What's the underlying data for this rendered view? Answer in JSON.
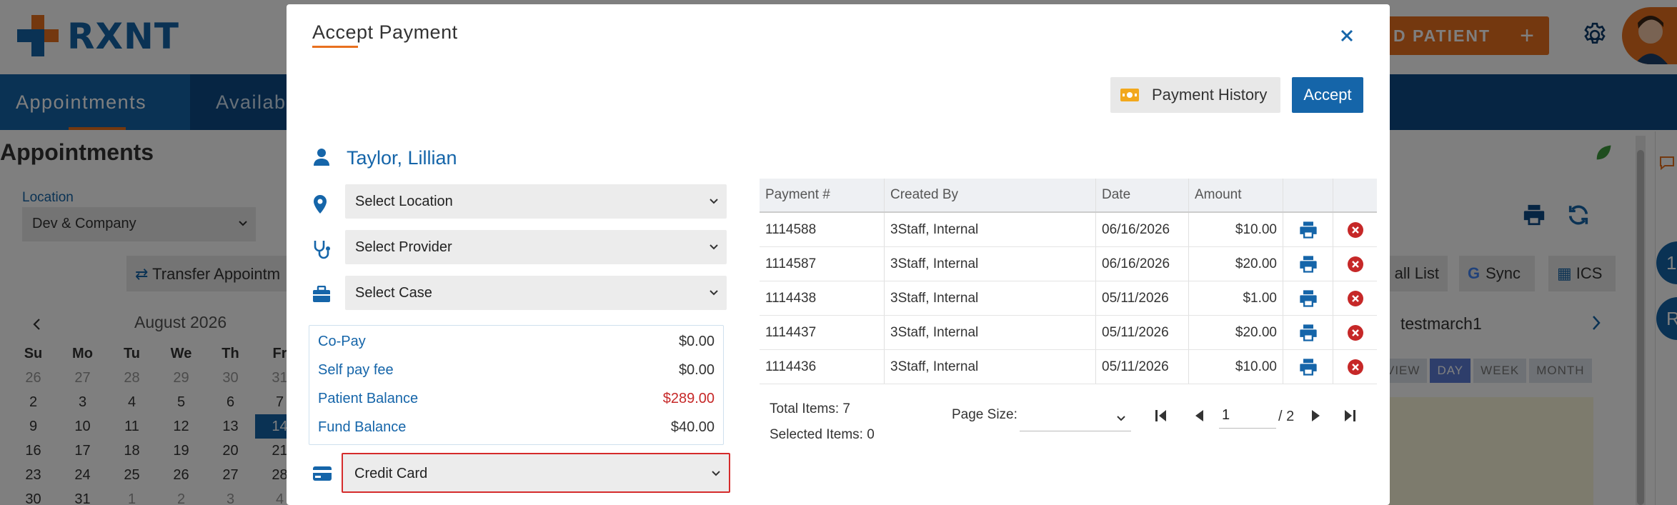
{
  "app": {
    "logo_text": "RXNT",
    "add_patient_label": "D PATIENT",
    "plus_label": "+"
  },
  "nav": {
    "tabs": [
      {
        "label": "Appointments",
        "active": true
      },
      {
        "label": "Availab",
        "active": false
      }
    ]
  },
  "page": {
    "title": "Appointments",
    "location_label": "Location",
    "location_value": "Dev & Company",
    "transfer_label": "Transfer Appointm",
    "right_buttons": {
      "call_list": "all List",
      "sync": "Sync",
      "ics": "ICS"
    },
    "testmarch": "testmarch1",
    "view_tabs": [
      {
        "label": "VIEW",
        "active": false
      },
      {
        "label": "DAY",
        "active": true
      },
      {
        "label": "WEEK",
        "active": false
      },
      {
        "label": "MONTH",
        "active": false
      }
    ],
    "far_right_badges": [
      "1",
      "R"
    ]
  },
  "calendar": {
    "month": "August 2026",
    "day_headers": [
      "Su",
      "Mo",
      "Tu",
      "We",
      "Th",
      "Fr"
    ],
    "weeks": [
      [
        "26",
        "27",
        "28",
        "29",
        "30",
        "31"
      ],
      [
        "2",
        "3",
        "4",
        "5",
        "6",
        "7"
      ],
      [
        "9",
        "10",
        "11",
        "12",
        "13",
        "14"
      ],
      [
        "16",
        "17",
        "18",
        "19",
        "20",
        "21"
      ],
      [
        "23",
        "24",
        "25",
        "26",
        "27",
        "28"
      ],
      [
        "30",
        "31",
        "1",
        "2",
        "3",
        "4"
      ]
    ],
    "selected": "14"
  },
  "modal": {
    "title": "Accept Payment",
    "payment_history_label": "Payment History",
    "accept_label": "Accept",
    "patient_name": "Taylor, Lillian",
    "location_select": "Select Location",
    "provider_select": "Select Provider",
    "case_select": "Select Case",
    "balances": [
      {
        "label": "Co-Pay",
        "value": "$0.00",
        "alert": false
      },
      {
        "label": "Self pay fee",
        "value": "$0.00",
        "alert": false
      },
      {
        "label": "Patient Balance",
        "value": "$289.00",
        "alert": true
      },
      {
        "label": "Fund Balance",
        "value": "$40.00",
        "alert": false
      }
    ],
    "payment_method": "Credit Card",
    "grid": {
      "headers": [
        "Payment #",
        "Created By",
        "Date",
        "Amount",
        "",
        ""
      ],
      "rows": [
        {
          "payment": "1114588",
          "created_by": "3Staff, Internal",
          "date": "06/16/2026",
          "amount": "$10.00"
        },
        {
          "payment": "1114587",
          "created_by": "3Staff, Internal",
          "date": "06/16/2026",
          "amount": "$20.00"
        },
        {
          "payment": "1114438",
          "created_by": "3Staff, Internal",
          "date": "05/11/2026",
          "amount": "$1.00"
        },
        {
          "payment": "1114437",
          "created_by": "3Staff, Internal",
          "date": "05/11/2026",
          "amount": "$20.00"
        },
        {
          "payment": "1114436",
          "created_by": "3Staff, Internal",
          "date": "05/11/2026",
          "amount": "$10.00"
        }
      ],
      "total_items": "Total Items: 7",
      "selected_items": "Selected Items: 0",
      "page_size_label": "Page Size:",
      "page_size_value": "",
      "current_page": "1",
      "total_pages": "/ 2"
    }
  },
  "colors": {
    "brand_blue": "#1565a9",
    "nav_dark": "#0d4a86",
    "accent_orange": "#e8701f",
    "alert_red": "#c62828",
    "highlight_border": "#d52b2b"
  }
}
